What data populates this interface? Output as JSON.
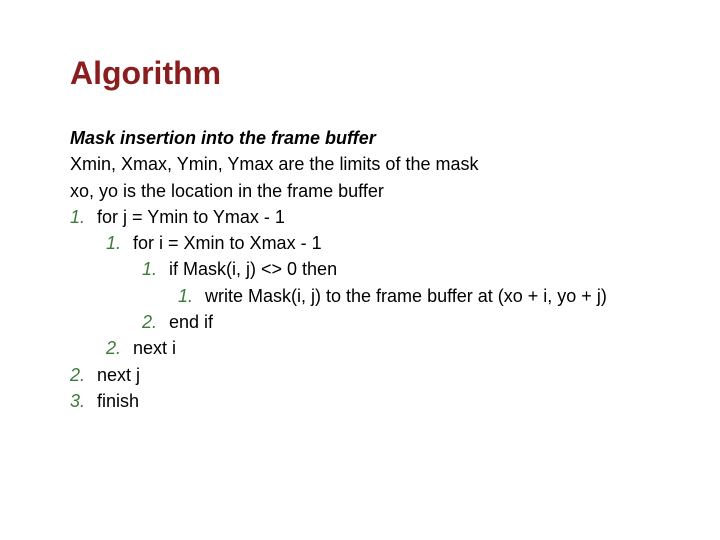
{
  "title": "Algorithm",
  "subheading": "Mask insertion into the frame buffer",
  "desc": [
    "Xmin, Xmax, Ymin, Ymax are the limits of the mask",
    "xo, yo is the location in the frame buffer"
  ],
  "algo": [
    {
      "num": "1.",
      "text": "for j = Ymin to Ymax - 1"
    },
    {
      "num": "1.",
      "text": "for i = Xmin to Xmax - 1"
    },
    {
      "num": "1.",
      "text": "if Mask(i, j) <> 0 then"
    },
    {
      "num": "1.",
      "text": "write Mask(i, j) to the frame buffer at (xo + i, yo + j)"
    },
    {
      "num": "2.",
      "text": "end if"
    },
    {
      "num": "2.",
      "text": "next i"
    },
    {
      "num": "2.",
      "text": "next j"
    },
    {
      "num": "3.",
      "text": "finish"
    }
  ],
  "colors": {
    "title": "#8a1e1e",
    "line_number": "#3b7a3b",
    "text": "#000000",
    "background": "#ffffff"
  }
}
